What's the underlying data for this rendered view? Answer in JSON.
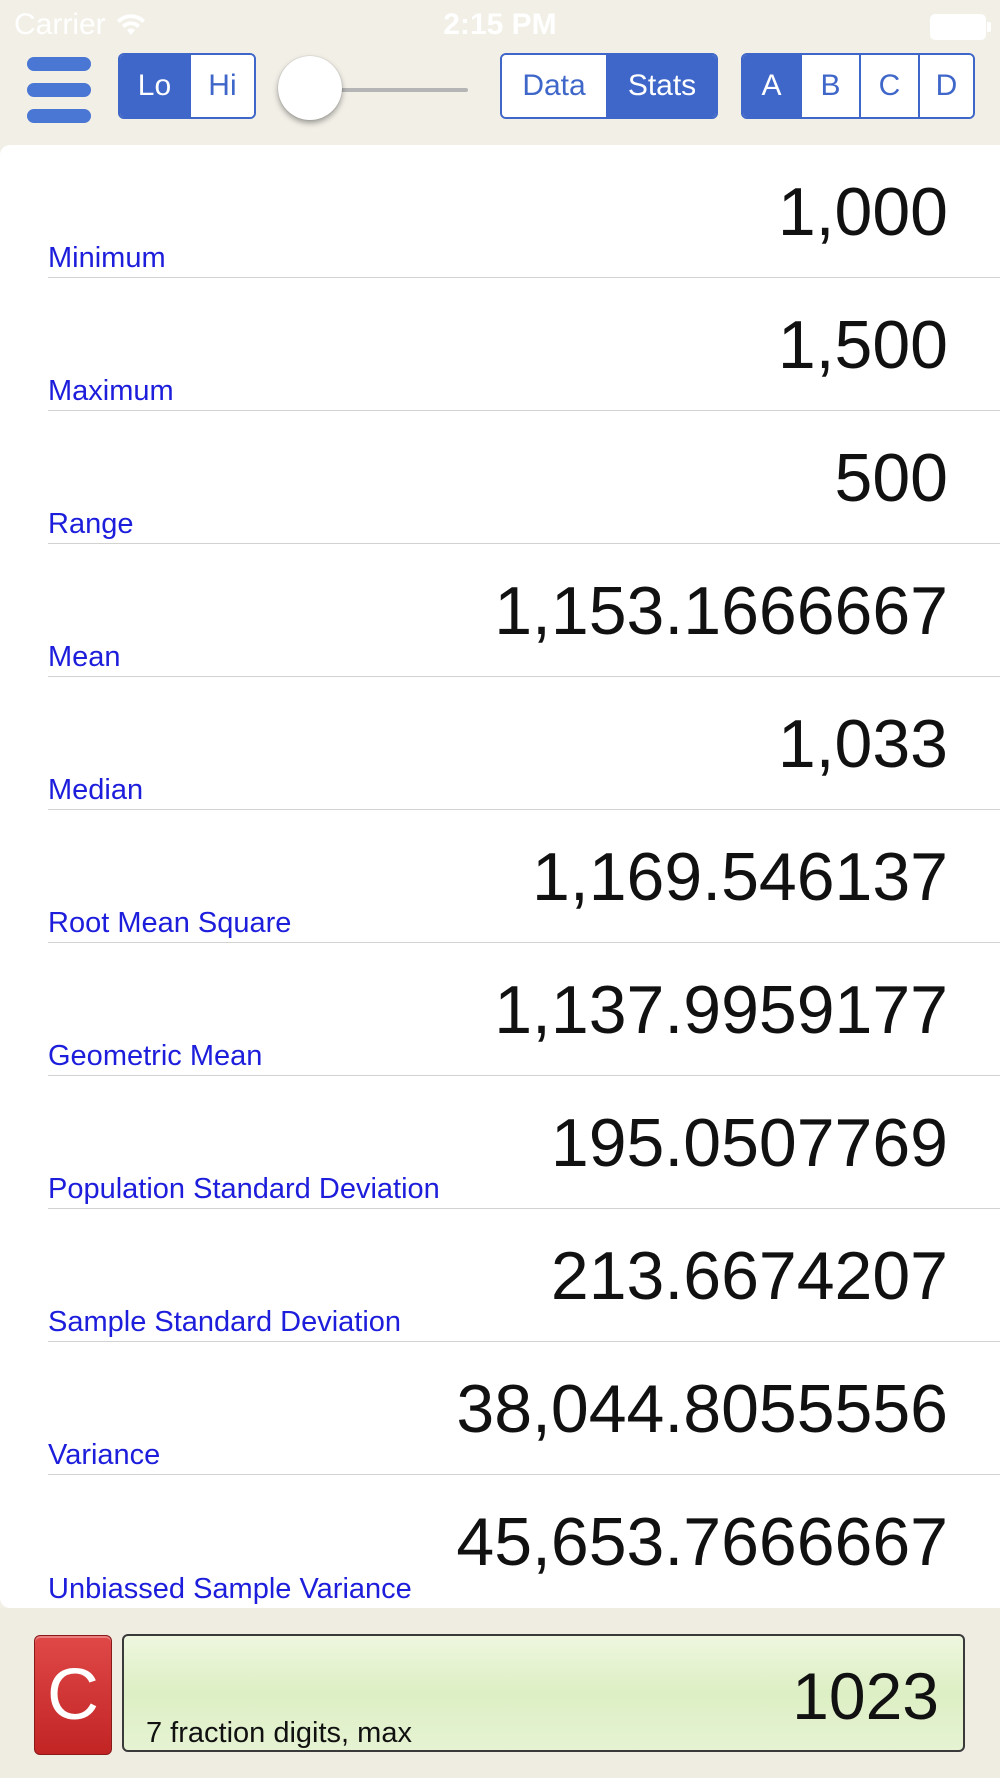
{
  "status_bar": {
    "carrier": "Carrier",
    "time": "2:15 PM"
  },
  "toolbar": {
    "menu_icon": "hamburger-menu-icon",
    "range_toggle": {
      "options": [
        "Lo",
        "Hi"
      ],
      "selected": "Lo"
    },
    "slider_value": 0,
    "view_toggle": {
      "options": [
        "Data",
        "Stats"
      ],
      "selected": "Stats"
    },
    "dataset_toggle": {
      "options": [
        "A",
        "B",
        "C",
        "D"
      ],
      "selected": "A"
    }
  },
  "stats": [
    {
      "label": "Minimum",
      "value": "1,000"
    },
    {
      "label": "Maximum",
      "value": "1,500"
    },
    {
      "label": "Range",
      "value": "500"
    },
    {
      "label": "Mean",
      "value": "1,153.1666667"
    },
    {
      "label": "Median",
      "value": "1,033"
    },
    {
      "label": "Root Mean Square",
      "value": "1,169.546137"
    },
    {
      "label": "Geometric Mean",
      "value": "1,137.9959177"
    },
    {
      "label": "Population Standard Deviation",
      "value": "195.0507769"
    },
    {
      "label": "Sample Standard Deviation",
      "value": "213.6674207"
    },
    {
      "label": "Variance",
      "value": "38,044.8055556"
    },
    {
      "label": "Unbiassed Sample Variance",
      "value": "45,653.7666667"
    }
  ],
  "bottom": {
    "clear_label": "C",
    "display_value": "1023",
    "display_caption": "7 fraction digits, max"
  },
  "colors": {
    "accent": "#3f67c9",
    "label_text": "#1d1ddc",
    "clear_button": "#d33636",
    "display_bg": "#e2f1cc"
  }
}
